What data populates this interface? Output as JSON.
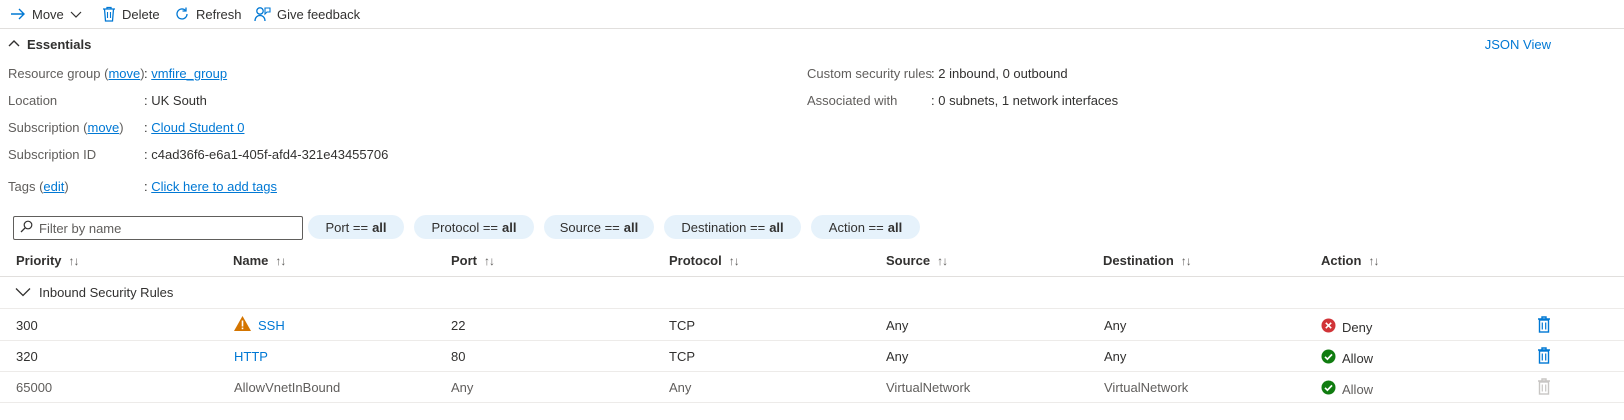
{
  "toolbar": {
    "move_label": "Move",
    "delete_label": "Delete",
    "refresh_label": "Refresh",
    "feedback_label": "Give feedback"
  },
  "essentials": {
    "title": "Essentials",
    "json_view": "JSON View",
    "resource_group": {
      "label": "Resource group",
      "action": "move",
      "value": "vmfire_group"
    },
    "location": {
      "label": "Location",
      "value": "UK South"
    },
    "subscription": {
      "label": "Subscription",
      "action": "move",
      "value": "Cloud Student 0"
    },
    "subscription_id": {
      "label": "Subscription ID",
      "value": "c4ad36f6-e6a1-405f-afd4-321e43455706"
    },
    "tags": {
      "label": "Tags",
      "action": "edit",
      "value": "Click here to add tags"
    },
    "custom_rules": {
      "label": "Custom security rules",
      "value": "2 inbound, 0 outbound"
    },
    "associated_with": {
      "label": "Associated with",
      "value": "0 subnets, 1 network interfaces"
    }
  },
  "filters": {
    "search_placeholder": "Filter by name",
    "pills": [
      {
        "name": "Port ==",
        "value": "all"
      },
      {
        "name": "Protocol ==",
        "value": "all"
      },
      {
        "name": "Source ==",
        "value": "all"
      },
      {
        "name": "Destination ==",
        "value": "all"
      },
      {
        "name": "Action ==",
        "value": "all"
      }
    ]
  },
  "table": {
    "columns": [
      "Priority",
      "Name",
      "Port",
      "Protocol",
      "Source",
      "Destination",
      "Action"
    ],
    "group_label": "Inbound Security Rules",
    "rows": [
      {
        "priority": "300",
        "name": "SSH",
        "warning": true,
        "port": "22",
        "protocol": "TCP",
        "source": "Any",
        "destination": "Any",
        "action": "Deny"
      },
      {
        "priority": "320",
        "name": "HTTP",
        "warning": false,
        "port": "80",
        "protocol": "TCP",
        "source": "Any",
        "destination": "Any",
        "action": "Allow"
      },
      {
        "priority": "65000",
        "name": "AllowVnetInBound",
        "warning": false,
        "port": "Any",
        "protocol": "Any",
        "source": "VirtualNetwork",
        "destination": "VirtualNetwork",
        "action": "Allow"
      }
    ]
  },
  "colors": {
    "accent": "#0078d4",
    "deny": "#d13438",
    "allow": "#107c10",
    "warning": "#d47500",
    "pill_bg": "#e6f2fb"
  }
}
